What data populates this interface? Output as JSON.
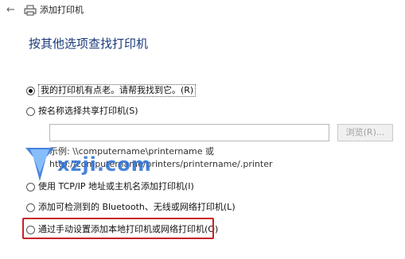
{
  "titlebar": {
    "back_icon": "back-arrow-icon",
    "app_icon": "printer-icon",
    "title": "添加打印机"
  },
  "heading": "按其他选项查找打印机",
  "options": [
    {
      "label": "我的打印机有点老。请帮我找到它。(R)",
      "checked": true
    },
    {
      "label": "按名称选择共享打印机(S)",
      "checked": false
    },
    {
      "label": "使用 TCP/IP 地址或主机名添加打印机(I)",
      "checked": false
    },
    {
      "label": "添加可检测到的 Bluetooth、无线或网络打印机(L)",
      "checked": false
    },
    {
      "label": "通过手动设置添加本地打印机或网络打印机(O)",
      "checked": false
    }
  ],
  "share": {
    "input_value": "",
    "browse_label": "浏览(R)...",
    "example_line1": "示例: \\\\computername\\printername 或",
    "example_line2": "http://computername/printers/printername/.printer"
  },
  "watermark": {
    "text": "xzji.com",
    "logo": "download-site-logo"
  },
  "colors": {
    "heading": "#1b3a7a",
    "highlight": "#c8202a",
    "watermark": "#2a6fd6"
  }
}
